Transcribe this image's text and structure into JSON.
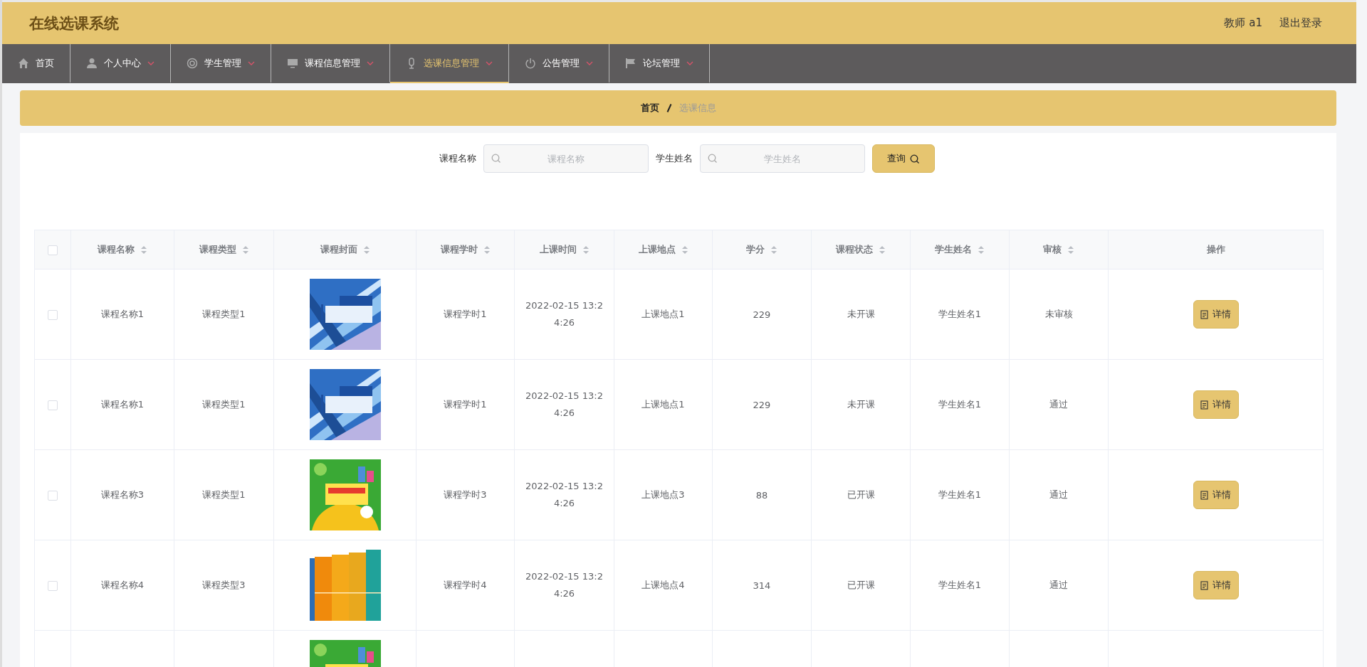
{
  "app": {
    "title": "在线选课系统",
    "user": "教师 a1",
    "logout": "退出登录"
  },
  "nav": [
    {
      "label": "首页",
      "dropdown": false,
      "selected": false
    },
    {
      "label": "个人中心",
      "dropdown": true,
      "selected": false
    },
    {
      "label": "学生管理",
      "dropdown": true,
      "selected": false
    },
    {
      "label": "课程信息管理",
      "dropdown": true,
      "selected": false
    },
    {
      "label": "选课信息管理",
      "dropdown": true,
      "selected": true
    },
    {
      "label": "公告管理",
      "dropdown": true,
      "selected": false
    },
    {
      "label": "论坛管理",
      "dropdown": true,
      "selected": false
    }
  ],
  "breadcrumb": [
    "首页",
    "选课信息"
  ],
  "search": {
    "fields": [
      {
        "label": "课程名称",
        "placeholder": "课程名称"
      },
      {
        "label": "学生姓名",
        "placeholder": "学生姓名"
      }
    ],
    "button": "查询"
  },
  "table": {
    "select_all": {
      "checked": false
    },
    "columns": [
      {
        "label": "课程名称",
        "sortable": true
      },
      {
        "label": "课程类型",
        "sortable": true
      },
      {
        "label": "课程封面",
        "sortable": true
      },
      {
        "label": "课程学时",
        "sortable": true
      },
      {
        "label": "上课时间",
        "sortable": true
      },
      {
        "label": "上课地点",
        "sortable": true
      },
      {
        "label": "学分",
        "sortable": true
      },
      {
        "label": "课程状态",
        "sortable": true
      },
      {
        "label": "学生姓名",
        "sortable": true
      },
      {
        "label": "审核",
        "sortable": true
      },
      {
        "label": "操作",
        "sortable": false
      }
    ],
    "rows": [
      {
        "checked": false,
        "name": "课程名称1",
        "type": "课程类型1",
        "cover": {
          "kind": "picture"
        },
        "hours": "课程学时1",
        "time": "2022-02-15 13:24:26",
        "place": "上课地点1",
        "credit": "229",
        "status": "未开课",
        "student": "学生姓名1",
        "audit": "未审核",
        "action": "详情"
      },
      {
        "checked": false,
        "name": "课程名称1",
        "type": "课程类型1",
        "cover": {
          "kind": "picture"
        },
        "hours": "课程学时1",
        "time": "2022-02-15 13:24:26",
        "place": "上课地点1",
        "credit": "229",
        "status": "未开课",
        "student": "学生姓名1",
        "audit": "通过",
        "action": "详情"
      },
      {
        "checked": false,
        "name": "课程名称3",
        "type": "课程类型1",
        "cover": {
          "kind": "picture"
        },
        "hours": "课程学时3",
        "time": "2022-02-15 13:24:26",
        "place": "上课地点3",
        "credit": "88",
        "status": "已开课",
        "student": "学生姓名1",
        "audit": "通过",
        "action": "详情"
      },
      {
        "checked": false,
        "name": "课程名称4",
        "type": "课程类型3",
        "cover": {
          "kind": "picture"
        },
        "hours": "课程学时4",
        "time": "2022-02-15 13:24:26",
        "place": "上课地点4",
        "credit": "314",
        "status": "已开课",
        "student": "学生姓名1",
        "audit": "通过",
        "action": "详情"
      },
      {
        "cover": {
          "kind": "picture"
        }
      }
    ]
  }
}
